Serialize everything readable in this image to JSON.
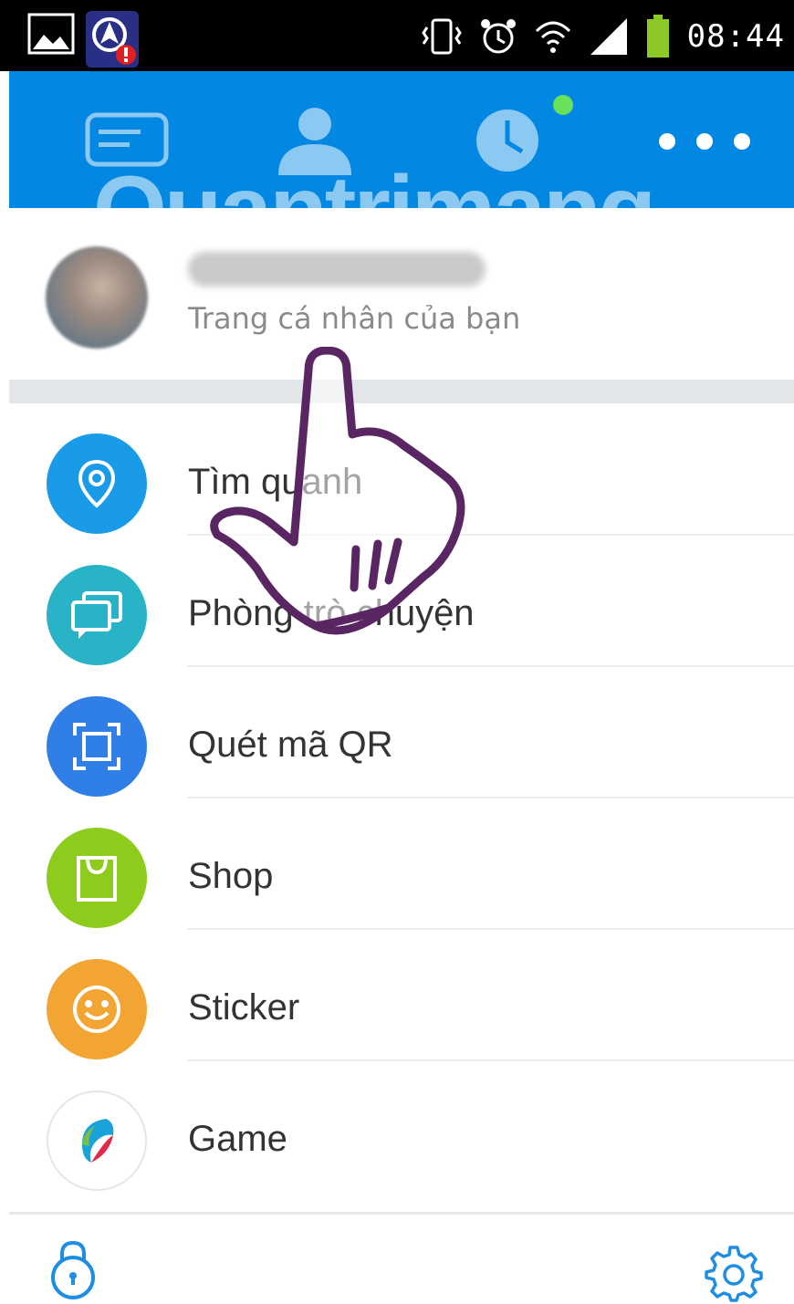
{
  "status_bar": {
    "time": "08:44"
  },
  "header": {
    "watermark": "Quantrimang"
  },
  "profile": {
    "subtitle": "Trang cá nhân của bạn"
  },
  "menu": {
    "items": [
      {
        "label": "Tìm quanh",
        "icon": "location-pin-icon",
        "color": "#1a9be8"
      },
      {
        "label": "Phòng trò chuyện",
        "icon": "chat-rooms-icon",
        "color": "#29b3c6"
      },
      {
        "label": "Quét mã QR",
        "icon": "qr-scan-icon",
        "color": "#2f7fe6"
      },
      {
        "label": "Shop",
        "icon": "shopping-bag-icon",
        "color": "#8dcc1c"
      },
      {
        "label": "Sticker",
        "icon": "smiley-icon",
        "color": "#f3a534"
      },
      {
        "label": "Game",
        "icon": "game-logo-icon",
        "color": "#ffffff"
      }
    ]
  },
  "colors": {
    "header": "#0288e3",
    "status_bar": "#000000",
    "accent": "#1f8de0"
  }
}
